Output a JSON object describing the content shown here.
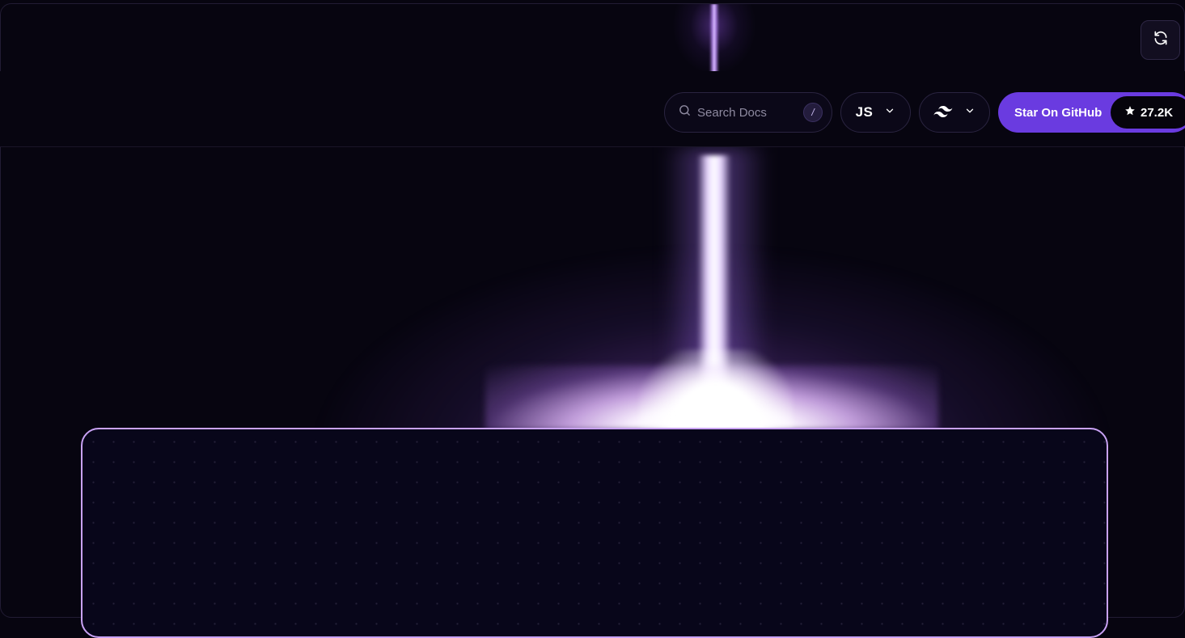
{
  "toolbar": {
    "refresh_icon": "refresh-icon"
  },
  "header": {
    "search": {
      "placeholder": "Search Docs",
      "shortcut": "/",
      "icon": "search-icon"
    },
    "language_selector": {
      "value": "JS",
      "icon": "chevron-down-icon"
    },
    "styling_selector": {
      "icon": "tailwind-icon",
      "chevron": "chevron-down-icon"
    },
    "github": {
      "label": "Star On GitHub",
      "stars": "27.2K",
      "icon": "star-icon"
    }
  },
  "colors": {
    "background": "#070510",
    "accent": "#6a3be0",
    "card_border": "#c9a2f5",
    "glow": "#e8d6ff"
  }
}
